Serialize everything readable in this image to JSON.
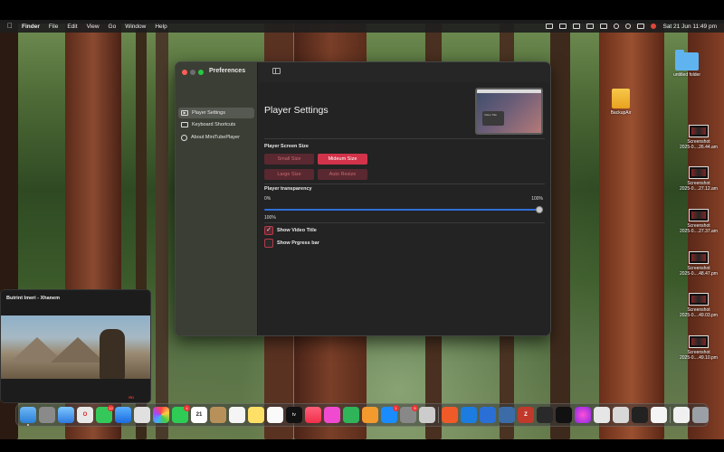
{
  "menubar": {
    "app_name": "Finder",
    "items": [
      "File",
      "Edit",
      "View",
      "Go",
      "Window",
      "Help"
    ],
    "datetime": "Sat 21 Jun  11:49 pm"
  },
  "preferences": {
    "window_title": "Preferences",
    "sidebar": [
      {
        "label": "Player Settings",
        "active": true
      },
      {
        "label": "Keyboard Shortcuts",
        "active": false
      },
      {
        "label": "About MiniTubePlayer",
        "active": false
      }
    ],
    "heading": "Player Settings",
    "preview_caption": "Video Title",
    "screen_size": {
      "label": "Player Screen Size",
      "options": [
        "Small Size",
        "Mideum Size",
        "Large Size",
        "Auto Resize"
      ],
      "selected": "Mideum Size"
    },
    "transparency": {
      "label": "Player transparency",
      "min_label": "0%",
      "max_label": "100%",
      "current_label": "100%",
      "value": 1.0
    },
    "checkboxes": [
      {
        "label": "Show Video Title",
        "checked": true
      },
      {
        "label": "Show Prgress bar",
        "checked": false
      }
    ]
  },
  "miniplayer": {
    "title": "Butrint Imeri - Xhanem",
    "watermark": "RD"
  },
  "desktop_icons": [
    {
      "name": "untitled folder",
      "line2": ""
    },
    {
      "name": "BackupAir",
      "line2": ""
    },
    {
      "name": "Screenshot",
      "line2": "2025-0....26.44.am"
    },
    {
      "name": "Screenshot",
      "line2": "2025-0....27.12.am"
    },
    {
      "name": "Screenshot",
      "line2": "2025-0....27.37.am"
    },
    {
      "name": "Screenshot",
      "line2": "2025-0....48.47.pm"
    },
    {
      "name": "Screenshot",
      "line2": "2025-0....49.03.pm"
    },
    {
      "name": "Screenshot",
      "line2": "2025-0....49.10.pm"
    }
  ],
  "dock": {
    "calendar_day": "21",
    "tv_label": "tv",
    "badges": [
      "12",
      "4",
      "1",
      "5"
    ],
    "colors": {
      "accent_red": "#d3334a",
      "slider_blue": "#2f6fd6"
    }
  }
}
